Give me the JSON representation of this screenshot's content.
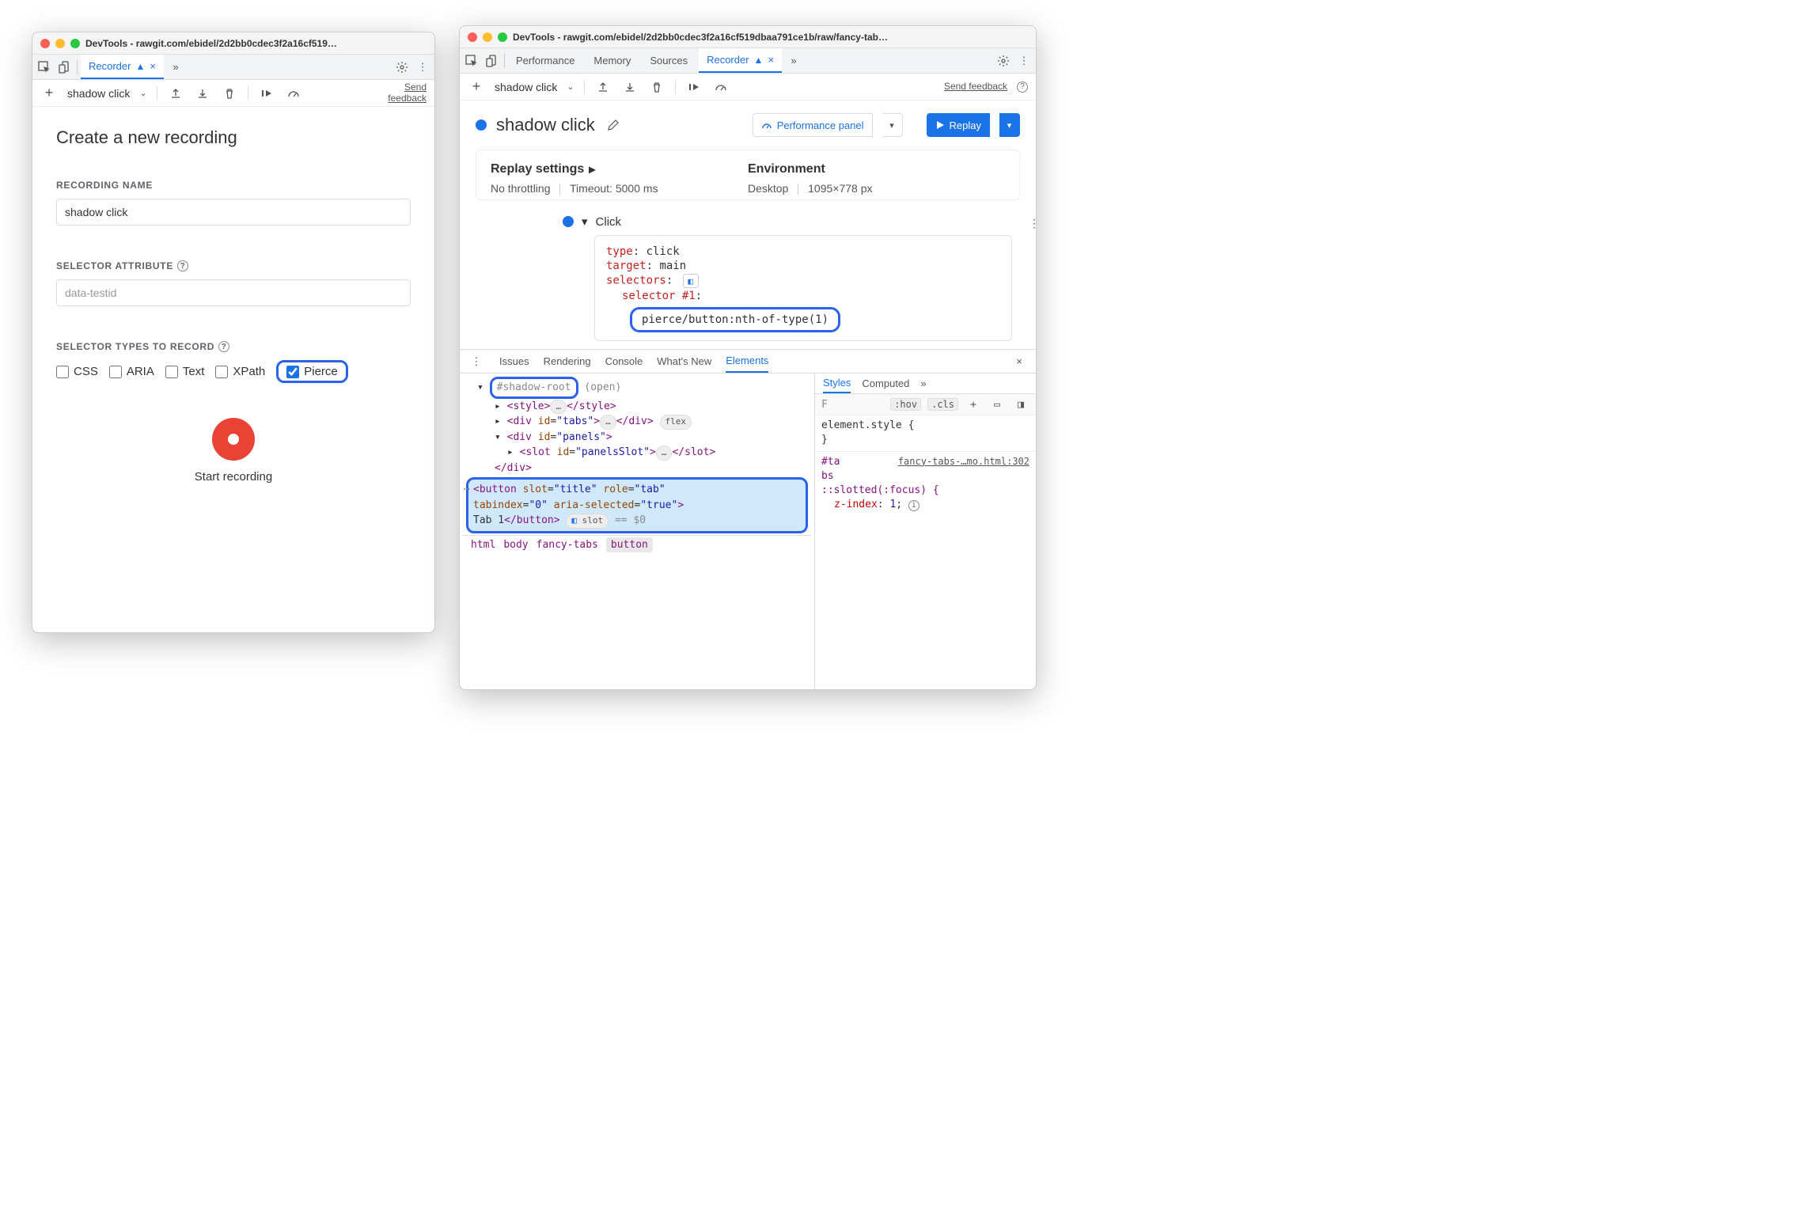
{
  "leftWindow": {
    "title": "DevTools - rawgit.com/ebidel/2d2bb0cdec3f2a16cf519…",
    "tab_recorder": "Recorder",
    "recording_select": "shadow click",
    "feedback_link": "Send feedback",
    "main_heading": "Create a new recording",
    "name_label": "RECORDING NAME",
    "name_value": "shadow click",
    "selector_attr_label": "SELECTOR ATTRIBUTE",
    "selector_attr_placeholder": "data-testid",
    "types_label": "SELECTOR TYPES TO RECORD",
    "types": {
      "css": "CSS",
      "aria": "ARIA",
      "text": "Text",
      "xpath": "XPath",
      "pierce": "Pierce"
    },
    "start_recording": "Start recording"
  },
  "rightWindow": {
    "title": "DevTools - rawgit.com/ebidel/2d2bb0cdec3f2a16cf519dbaa791ce1b/raw/fancy-tab…",
    "tabs": {
      "performance": "Performance",
      "memory": "Memory",
      "sources": "Sources",
      "recorder": "Recorder"
    },
    "toolbar": {
      "recording_select": "shadow click",
      "feedback_link": "Send feedback"
    },
    "header": {
      "title": "shadow click",
      "perf_button": "Performance panel",
      "replay_button": "Replay"
    },
    "settings": {
      "replay_label": "Replay settings",
      "throttling": "No throttling",
      "timeout": "Timeout: 5000 ms",
      "env_label": "Environment",
      "device": "Desktop",
      "viewport": "1095×778 px"
    },
    "step": {
      "title": "Click",
      "type_k": "type",
      "type_v": "click",
      "target_k": "target",
      "target_v": "main",
      "selectors_k": "selectors",
      "selector_num": "selector #1",
      "selector_value": "pierce/button:nth-of-type(1)"
    },
    "drawer": {
      "tabs": {
        "issues": "Issues",
        "rendering": "Rendering",
        "console": "Console",
        "whatsnew": "What's New",
        "elements": "Elements"
      },
      "dom": {
        "shadow_root": "#shadow-root",
        "shadow_mode": "(open)",
        "style_open": "<style>",
        "style_close": "</style>",
        "tabs_open": "<div id=\"tabs\">",
        "tabs_close": "</div>",
        "flex_badge": "flex",
        "panels_open": "<div id=\"panels\">",
        "slot_open": "<slot id=\"panelsSlot\">",
        "slot_close": "</slot>",
        "div_close": "</div>",
        "button_line1": "<button slot=\"title\" role=\"tab\"",
        "button_line2": "tabindex=\"0\" aria-selected=\"true\">",
        "button_text_close": "Tab 1</button>",
        "slot_badge": "slot",
        "eq0": "== $0"
      },
      "crumbs": {
        "html": "html",
        "body": "body",
        "fancytabs": "fancy-tabs",
        "button": "button"
      },
      "styles": {
        "tab_styles": "Styles",
        "tab_computed": "Computed",
        "filter_placeholder": "F",
        "hov": ":hov",
        "cls": ".cls",
        "elem_style": "element.style {",
        "close_brace": "}",
        "rule_sel": "#tabs",
        "src": "fancy-tabs-…mo.html:302",
        "slotted": "::slotted(:focus) {",
        "zindex_k": "z-index",
        "zindex_v": "1"
      }
    }
  }
}
